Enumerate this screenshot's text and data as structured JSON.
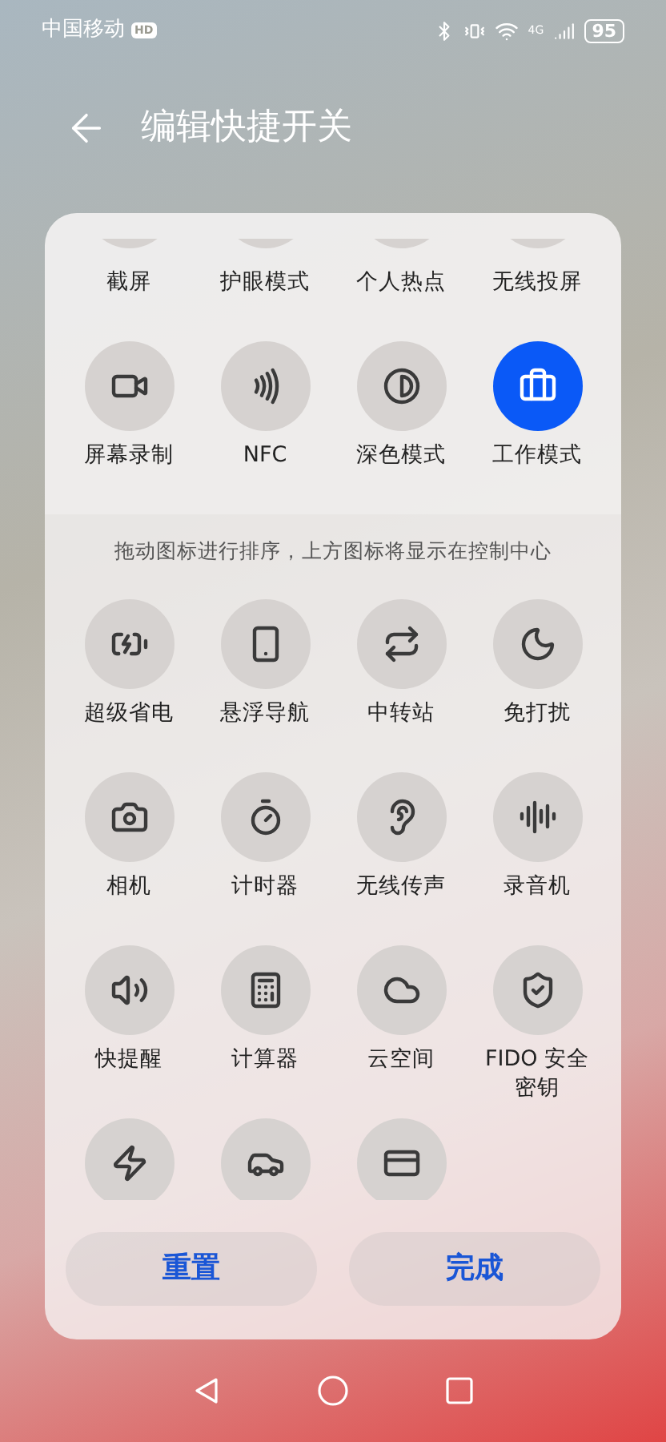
{
  "status_bar": {
    "carrier": "中国移动",
    "carrier_badge": "HD",
    "network": "4G",
    "battery": "95"
  },
  "header": {
    "title": "编辑快捷开关"
  },
  "active_partial": [
    {
      "label": "截屏"
    },
    {
      "label": "护眼模式"
    },
    {
      "label": "个人热点"
    },
    {
      "label": "无线投屏"
    }
  ],
  "active_tiles": [
    {
      "label": "屏幕录制",
      "on": false
    },
    {
      "label": "NFC",
      "on": false
    },
    {
      "label": "深色模式",
      "on": false
    },
    {
      "label": "工作模式",
      "on": true
    }
  ],
  "hint": "拖动图标进行排序，上方图标将显示在控制中心",
  "tiles": [
    {
      "label": "超级省电",
      "on": false
    },
    {
      "label": "悬浮导航",
      "on": false
    },
    {
      "label": "中转站",
      "on": false
    },
    {
      "label": "免打扰",
      "on": false
    },
    {
      "label": "相机",
      "on": false
    },
    {
      "label": "计时器",
      "on": false
    },
    {
      "label": "无线传声",
      "on": false
    },
    {
      "label": "录音机",
      "on": false
    },
    {
      "label": "快提醒",
      "on": false
    },
    {
      "label": "计算器",
      "on": false
    },
    {
      "label": "云空间",
      "on": false
    },
    {
      "label": "FIDO 安全密钥",
      "on": false
    }
  ],
  "buttons": [
    {
      "label": "重置"
    },
    {
      "label": "完成"
    }
  ]
}
